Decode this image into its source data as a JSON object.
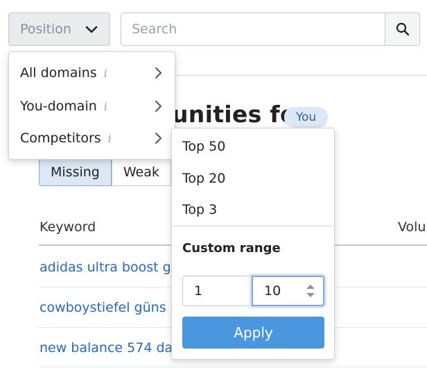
{
  "filter": {
    "position_label": "Position"
  },
  "search": {
    "placeholder": "Search",
    "value": ""
  },
  "page": {
    "title_fragment": "unities for",
    "badge": "You"
  },
  "tabs": [
    {
      "label": "Missing",
      "active": true
    },
    {
      "label": "Weak",
      "active": false
    }
  ],
  "table": {
    "headers": {
      "keyword": "Keyword",
      "volume": "Volu"
    },
    "rows": [
      {
        "keyword": "adidas ultra boost g"
      },
      {
        "keyword": "cowboystiefel güns"
      },
      {
        "keyword": "new balance 574 da"
      }
    ]
  },
  "position_menu": {
    "items": [
      {
        "label": "All domains",
        "info": "i"
      },
      {
        "label": "You-domain",
        "info": "i"
      },
      {
        "label": "Competitors",
        "info": "i"
      }
    ]
  },
  "submenu": {
    "presets": [
      {
        "label": "Top 50"
      },
      {
        "label": "Top 20"
      },
      {
        "label": "Top 3"
      }
    ],
    "custom_label": "Custom range",
    "range_from": "1",
    "range_to": "10",
    "apply_label": "Apply"
  },
  "colors": {
    "accent": "#4a97e0",
    "link": "#1f6bc5",
    "badge_bg": "#dce8f5"
  }
}
